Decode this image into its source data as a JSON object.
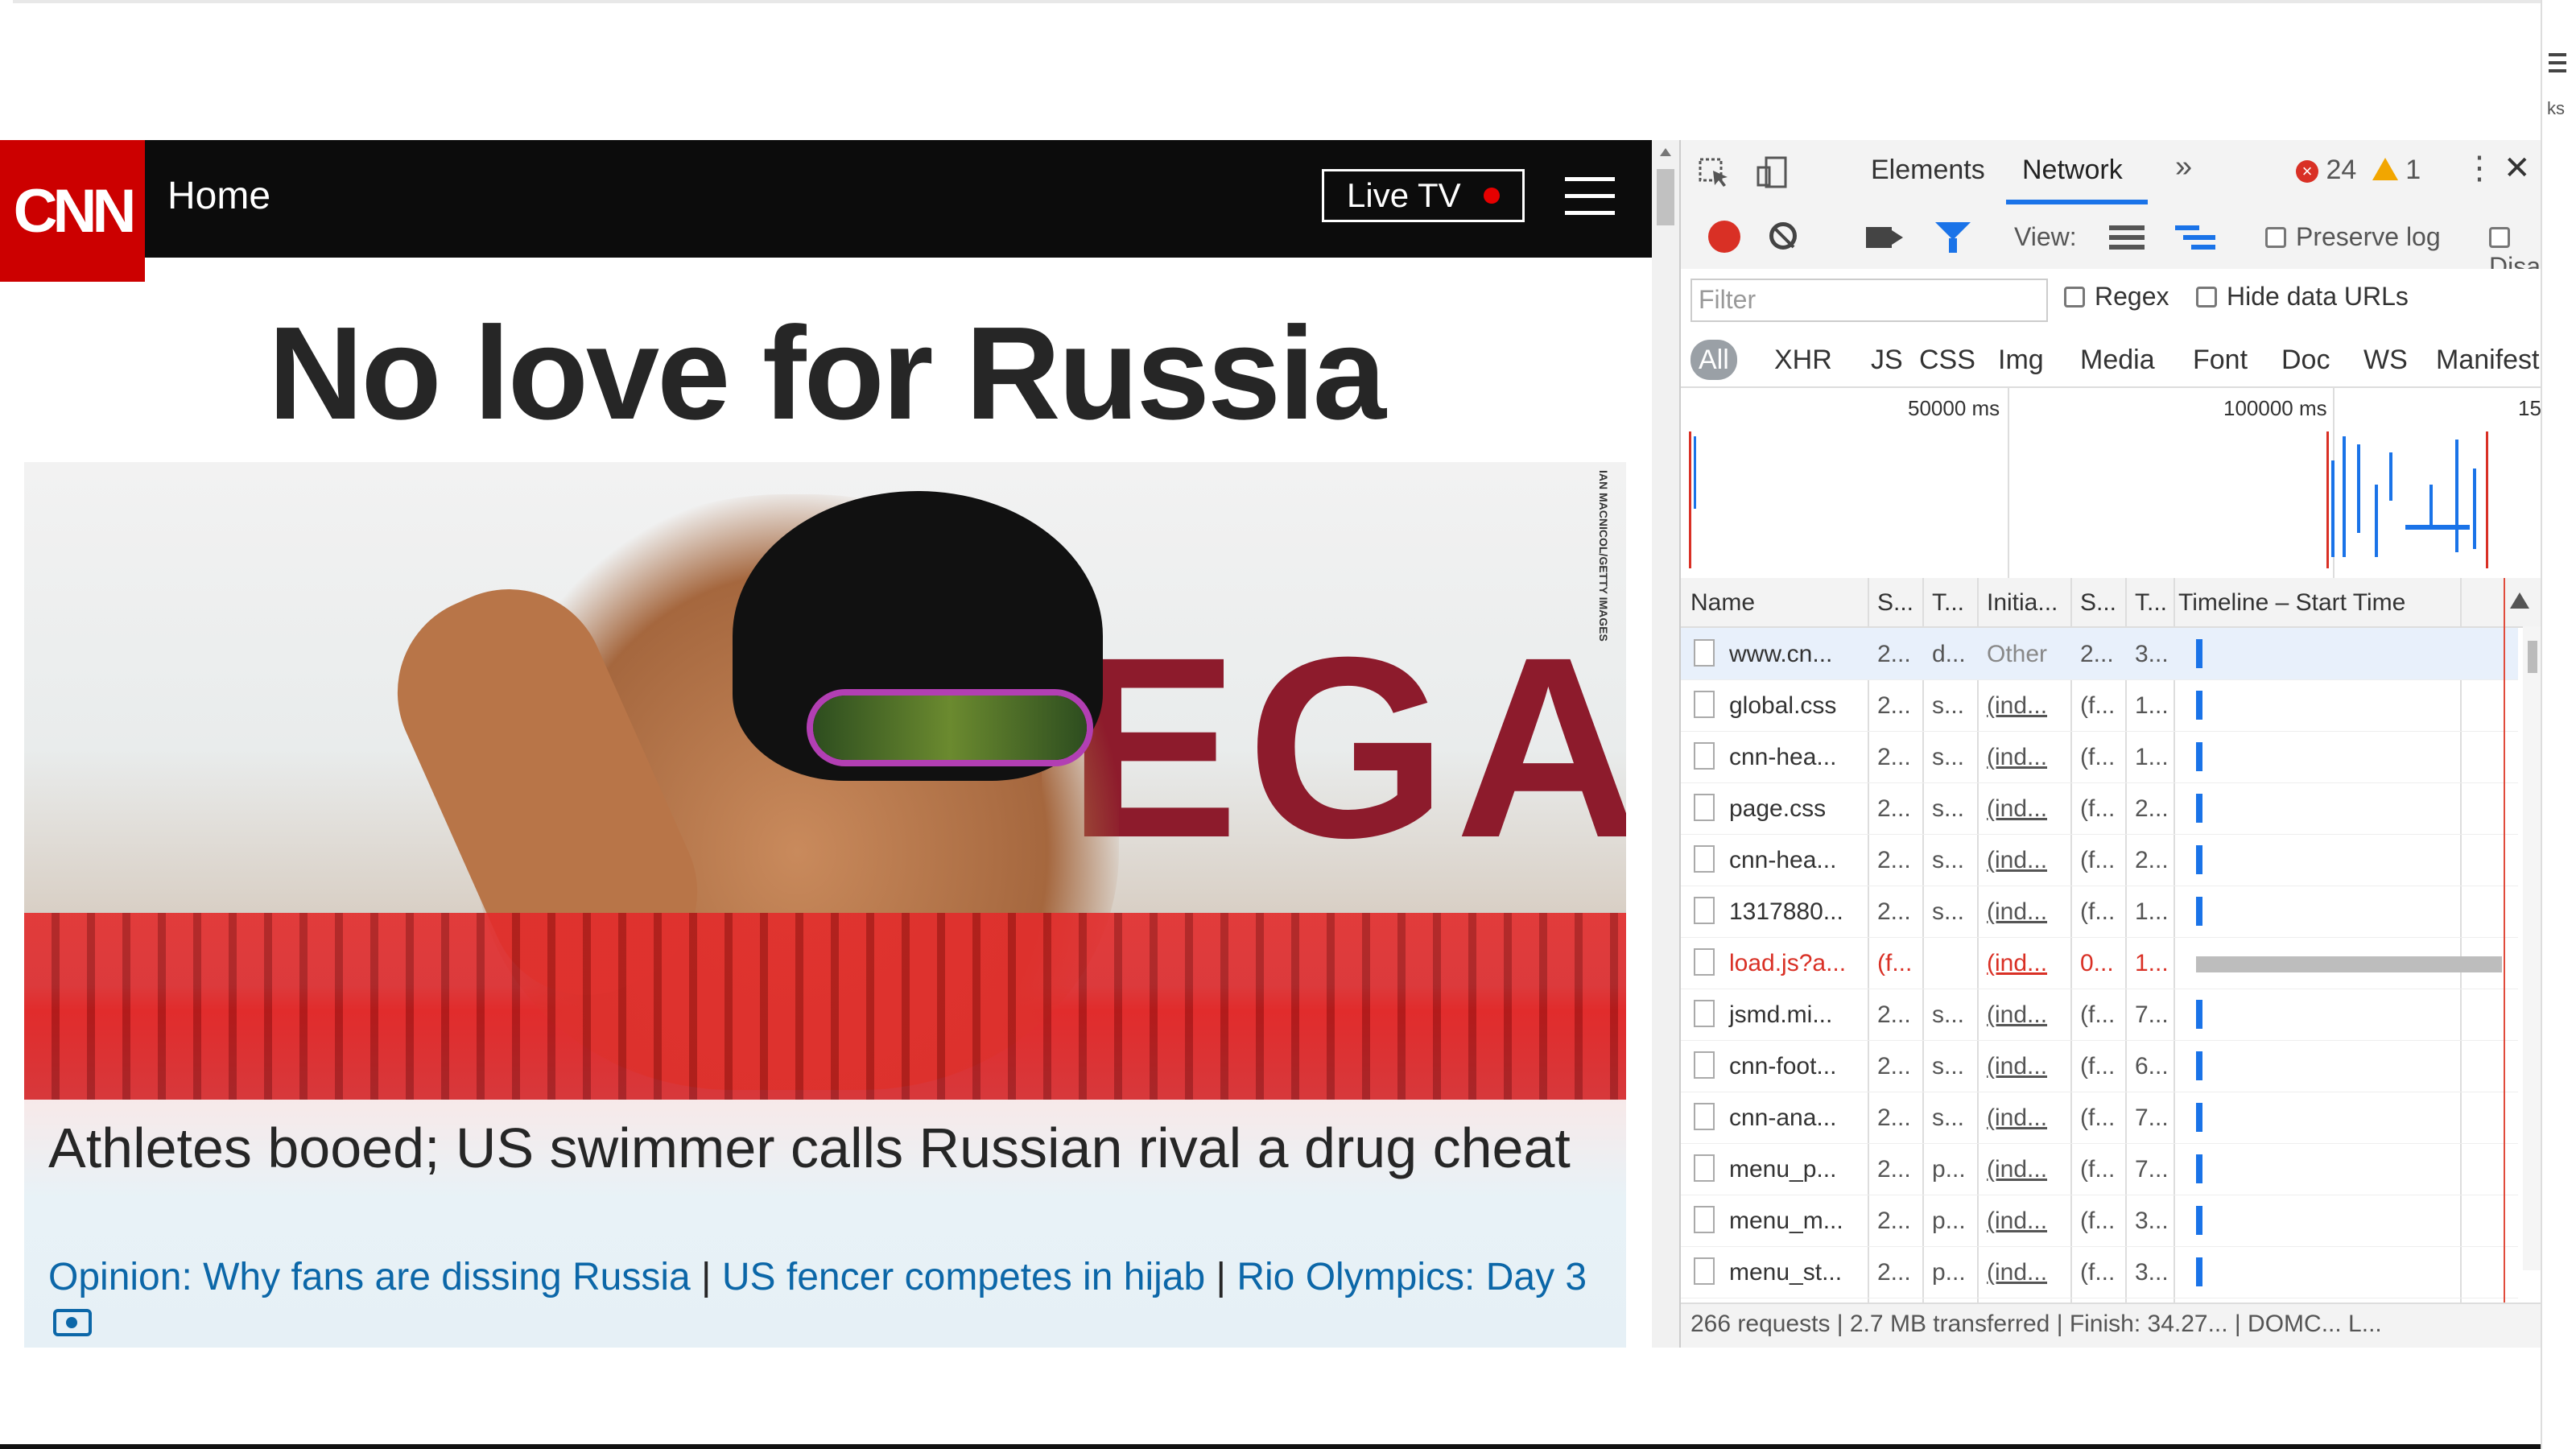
{
  "browser": {
    "side_label": "ks"
  },
  "cnn": {
    "logo": "CNN",
    "nav_home": "Home",
    "live_tv": "Live TV",
    "headline": "No love for Russia",
    "hero_credit": "IAN MACNICOL/GETTY IMAGES",
    "hero_brand_text": "OMEGA",
    "caption_title": "Athletes booed; US swimmer calls Russian rival a drug cheat",
    "caption_links": [
      "Opinion: Why fans are dissing Russia",
      "US fencer competes in hijab",
      "Rio Olympics: Day 3"
    ],
    "separator": "|"
  },
  "devtools": {
    "tabs": [
      "Elements",
      "Network"
    ],
    "more_tabs": "»",
    "error_count": "24",
    "warning_count": "1",
    "toolbar": {
      "view_label": "View:",
      "preserve_log": "Preserve log",
      "disable_cache": "Disa"
    },
    "filter": {
      "placeholder": "Filter",
      "regex": "Regex",
      "hide_data_urls": "Hide data URLs"
    },
    "types": [
      "All",
      "XHR",
      "JS",
      "CSS",
      "Img",
      "Media",
      "Font",
      "Doc",
      "WS",
      "Manifest"
    ],
    "overview_labels": [
      "50000 ms",
      "100000 ms",
      "15"
    ],
    "columns": [
      "Name",
      "S...",
      "T...",
      "Initia...",
      "S...",
      "T...",
      "Timeline – Start Time"
    ],
    "rows": [
      {
        "name": "www.cn...",
        "status": "2...",
        "type": "d...",
        "initiator": "Other",
        "size": "2...",
        "time": "3...",
        "selected": true
      },
      {
        "name": "global.css",
        "status": "2...",
        "type": "s...",
        "initiator": "(ind...",
        "size": "(f...",
        "time": "1..."
      },
      {
        "name": "cnn-hea...",
        "status": "2...",
        "type": "s...",
        "initiator": "(ind...",
        "size": "(f...",
        "time": "1..."
      },
      {
        "name": "page.css",
        "status": "2...",
        "type": "s...",
        "initiator": "(ind...",
        "size": "(f...",
        "time": "2..."
      },
      {
        "name": "cnn-hea...",
        "status": "2...",
        "type": "s...",
        "initiator": "(ind...",
        "size": "(f...",
        "time": "2..."
      },
      {
        "name": "1317880...",
        "status": "2...",
        "type": "s...",
        "initiator": "(ind...",
        "size": "(f...",
        "time": "1..."
      },
      {
        "name": "load.js?a...",
        "status": "(f...",
        "type": "",
        "initiator": "(ind...",
        "size": "0...",
        "time": "1...",
        "error": true
      },
      {
        "name": "jsmd.mi...",
        "status": "2...",
        "type": "s...",
        "initiator": "(ind...",
        "size": "(f...",
        "time": "7..."
      },
      {
        "name": "cnn-foot...",
        "status": "2...",
        "type": "s...",
        "initiator": "(ind...",
        "size": "(f...",
        "time": "6..."
      },
      {
        "name": "cnn-ana...",
        "status": "2...",
        "type": "s...",
        "initiator": "(ind...",
        "size": "(f...",
        "time": "7..."
      },
      {
        "name": "menu_p...",
        "status": "2...",
        "type": "p...",
        "initiator": "(ind...",
        "size": "(f...",
        "time": "7..."
      },
      {
        "name": "menu_m...",
        "status": "2...",
        "type": "p...",
        "initiator": "(ind...",
        "size": "(f...",
        "time": "3..."
      },
      {
        "name": "menu_st...",
        "status": "2...",
        "type": "p...",
        "initiator": "(ind...",
        "size": "(f...",
        "time": "3..."
      }
    ],
    "status_bar": "266 requests | 2.7 MB transferred | Finish: 34.27... | DOMC... L..."
  },
  "colors": {
    "cnn_red": "#cc0000",
    "link_blue": "#0c67a8",
    "devtools_blue": "#1a73e8",
    "error_red": "#d93025"
  }
}
